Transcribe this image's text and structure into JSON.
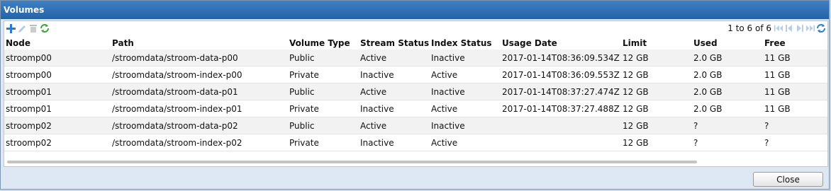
{
  "dialog": {
    "title": "Volumes",
    "close_label": "Close"
  },
  "toolbar": {
    "left_icons": [
      "add-icon",
      "edit-icon",
      "delete-icon",
      "refresh-icon"
    ],
    "pager": {
      "text": "1 to 6 of 6"
    },
    "right_icons": [
      "first-page-icon",
      "prev-page-icon",
      "next-page-icon",
      "last-page-icon",
      "refresh-icon"
    ]
  },
  "table": {
    "headers": {
      "node": "Node",
      "path": "Path",
      "volume_type": "Volume Type",
      "stream_status": "Stream Status",
      "index_status": "Index Status",
      "usage_date": "Usage Date",
      "limit": "Limit",
      "used": "Used",
      "free": "Free"
    },
    "rows": [
      {
        "node": "stroomp00",
        "path": "/stroomdata/stroom-data-p00",
        "volume_type": "Public",
        "stream_status": "Active",
        "index_status": "Inactive",
        "usage_date": "2017-01-14T08:36:09.534Z",
        "limit": "12 GB",
        "used": "2.0 GB",
        "free": "11 GB"
      },
      {
        "node": "stroomp00",
        "path": "/stroomdata/stroom-index-p00",
        "volume_type": "Private",
        "stream_status": "Inactive",
        "index_status": "Active",
        "usage_date": "2017-01-14T08:36:09.553Z",
        "limit": "12 GB",
        "used": "2.0 GB",
        "free": "11 GB"
      },
      {
        "node": "stroomp01",
        "path": "/stroomdata/stroom-data-p01",
        "volume_type": "Public",
        "stream_status": "Active",
        "index_status": "Inactive",
        "usage_date": "2017-01-14T08:37:27.474Z",
        "limit": "12 GB",
        "used": "2.0 GB",
        "free": "11 GB"
      },
      {
        "node": "stroomp01",
        "path": "/stroomdata/stroom-index-p01",
        "volume_type": "Private",
        "stream_status": "Inactive",
        "index_status": "Active",
        "usage_date": "2017-01-14T08:37:27.488Z",
        "limit": "12 GB",
        "used": "2.0 GB",
        "free": "11 GB"
      },
      {
        "node": "stroomp02",
        "path": "/stroomdata/stroom-data-p02",
        "volume_type": "Public",
        "stream_status": "Active",
        "index_status": "Inactive",
        "usage_date": "",
        "limit": "12 GB",
        "used": "?",
        "free": "?"
      },
      {
        "node": "stroomp02",
        "path": "/stroomdata/stroom-index-p02",
        "volume_type": "Private",
        "stream_status": "Inactive",
        "index_status": "Active",
        "usage_date": "",
        "limit": "12 GB",
        "used": "?",
        "free": "?"
      }
    ]
  }
}
